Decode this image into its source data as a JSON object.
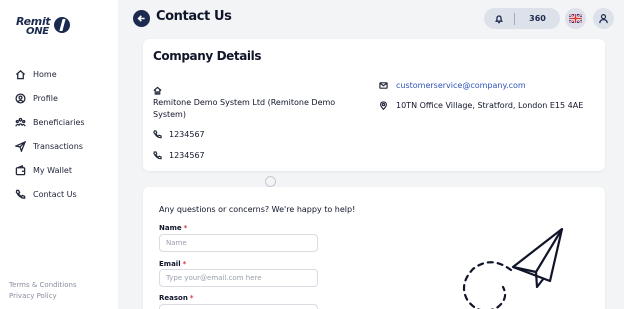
{
  "sidebar": {
    "logo_line1": "Remit",
    "logo_line2": "ONE",
    "items": [
      {
        "label": "Home",
        "icon": "home-icon"
      },
      {
        "label": "Profile",
        "icon": "profile-icon"
      },
      {
        "label": "Beneficiaries",
        "icon": "beneficiaries-icon"
      },
      {
        "label": "Transactions",
        "icon": "send-icon"
      },
      {
        "label": "My Wallet",
        "icon": "wallet-icon"
      },
      {
        "label": "Contact Us",
        "icon": "phone-icon"
      }
    ],
    "footer": {
      "terms": "Terms & Conditions",
      "privacy": "Privacy Policy"
    }
  },
  "header": {
    "title": "Contact Us",
    "points": "360",
    "language_flag": "uk-flag-icon"
  },
  "company": {
    "title": "Company Details",
    "name": "Remitone Demo System Ltd (Remitone Demo System)",
    "phone1": "1234567",
    "phone2": "1234567",
    "email": "customerservice@company.com",
    "address": "10TN Office Village, Stratford, London E15 4AE"
  },
  "form": {
    "intro": "Any questions or concerns? We're happy to help!",
    "name_label": "Name",
    "name_placeholder": "Name",
    "email_label": "Email",
    "email_placeholder": "Type your@email.com here",
    "reason_label": "Reason",
    "required_mark": "*"
  },
  "colors": {
    "brand_navy": "#1b2a4e",
    "link_blue": "#2f54b7",
    "required_red": "#d33a3a",
    "page_bg": "#f3f4f6"
  }
}
